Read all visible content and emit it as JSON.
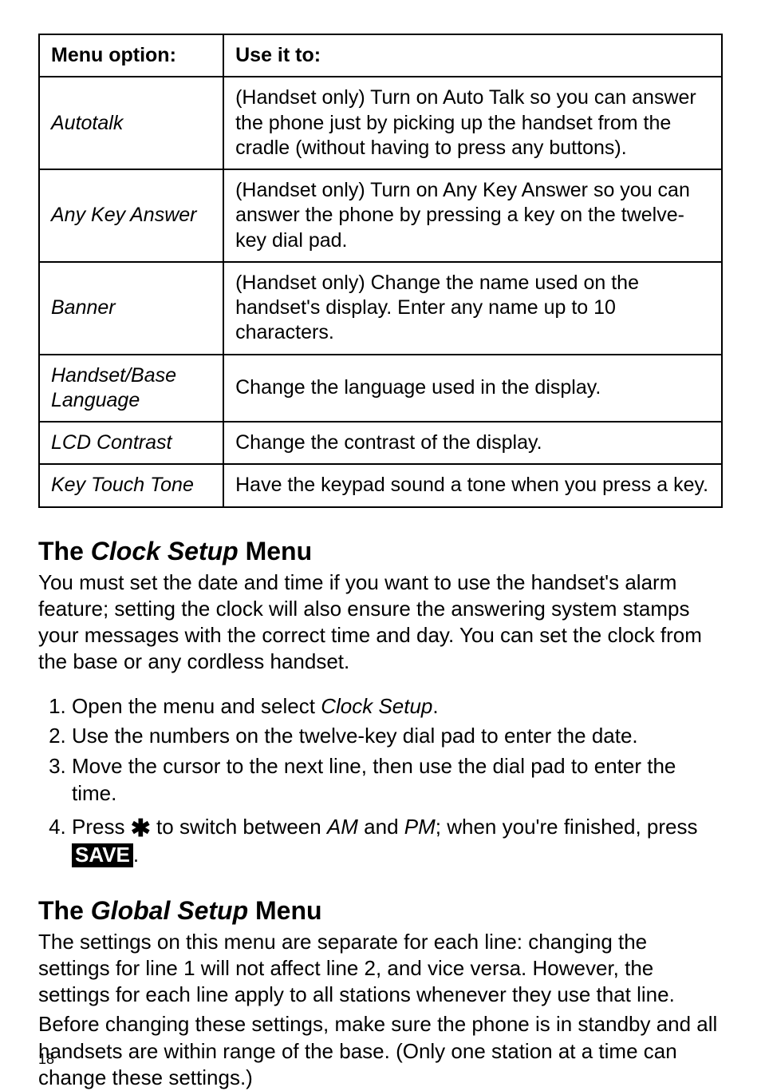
{
  "table": {
    "header": {
      "col1": "Menu option:",
      "col2": "Use it to:"
    },
    "rows": [
      {
        "option": "Autotalk",
        "desc": "(Handset only) Turn on Auto Talk so you can answer the phone just by picking up the handset from the cradle (without having to press any buttons)."
      },
      {
        "option": "Any Key Answer",
        "desc": "(Handset only) Turn on Any Key Answer so you can answer the phone by pressing a key on the twelve-key dial pad."
      },
      {
        "option": "Banner",
        "desc": "(Handset only) Change the name used on the handset's display. Enter any name up to 10 characters."
      },
      {
        "option": "Handset/Base Language",
        "desc": "Change the language used in the display."
      },
      {
        "option": "LCD Contrast",
        "desc": "Change the contrast of the display."
      },
      {
        "option": "Key Touch Tone",
        "desc": "Have the keypad sound a tone when you press a key."
      }
    ]
  },
  "clock": {
    "heading_the": "The ",
    "heading_name": "Clock Setup",
    "heading_menu": " Menu",
    "intro": "You must set the date and time if you want to use the handset's alarm feature; setting the clock will also ensure the answering system stamps your messages with the correct time and day. You can set the clock from the base or any cordless handset.",
    "step1_a": "Open the menu and select ",
    "step1_b": "Clock Setup",
    "step1_c": ".",
    "step2": "Use the numbers on the twelve-key dial pad to enter the date.",
    "step3": "Move the cursor to the next line, then use the dial pad to enter the time.",
    "step4_a": "Press ",
    "step4_star": "✱",
    "step4_b": " to switch between ",
    "step4_am": "AM",
    "step4_c": " and ",
    "step4_pm": "PM",
    "step4_d": "; when you're finished, press ",
    "step4_save": "SAVE",
    "step4_e": "."
  },
  "global": {
    "heading_the": "The ",
    "heading_name": "Global Setup",
    "heading_menu": " Menu",
    "p1": "The settings on this menu are separate for each line: changing the settings for line 1 will not affect line 2, and vice versa. However, the settings for each line apply to all stations whenever they use that line.",
    "p2": "Before changing these settings, make sure the phone is in standby and all handsets are within range of the base. (Only one station at a time can change these settings.)"
  },
  "page_number": "18"
}
